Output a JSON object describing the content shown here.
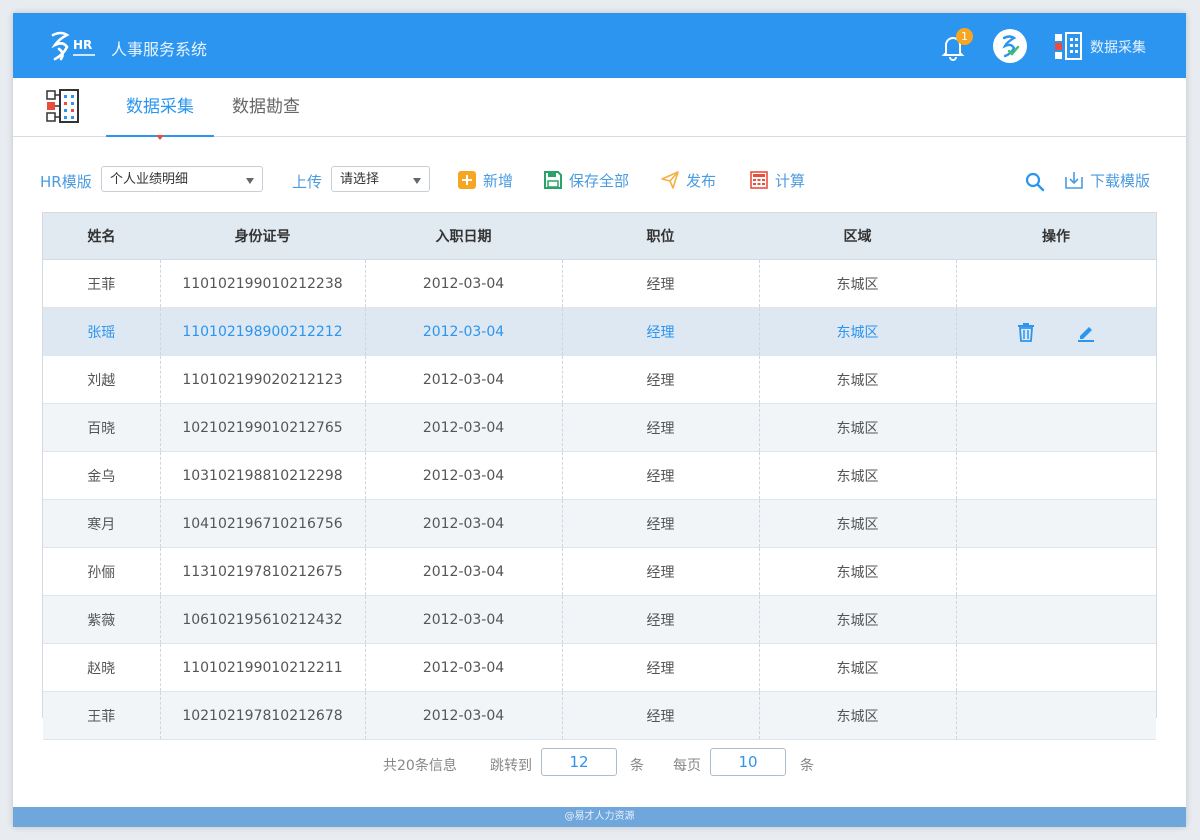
{
  "header": {
    "app_title": "人事服务系统",
    "notification_count": "1",
    "module_label": "数据采集"
  },
  "tabs": [
    {
      "label": "数据采集",
      "active": true
    },
    {
      "label": "数据勘查",
      "active": false
    }
  ],
  "toolbar": {
    "template_label": "HR模版",
    "template_value": "个人业绩明细",
    "upload_label": "上传",
    "upload_value": "请选择",
    "add_label": "新增",
    "save_all_label": "保存全部",
    "publish_label": "发布",
    "calculate_label": "计算",
    "download_label": "下载模版"
  },
  "table": {
    "columns": [
      "姓名",
      "身份证号",
      "入职日期",
      "职位",
      "区域",
      "操作"
    ],
    "rows": [
      {
        "name": "王菲",
        "id": "110102199010212238",
        "date": "2012-03-04",
        "position": "经理",
        "region": "东城区"
      },
      {
        "name": "张瑶",
        "id": "110102198900212212",
        "date": "2012-03-04",
        "position": "经理",
        "region": "东城区"
      },
      {
        "name": "刘越",
        "id": "110102199020212123",
        "date": "2012-03-04",
        "position": "经理",
        "region": "东城区"
      },
      {
        "name": "百晓",
        "id": "102102199010212765",
        "date": "2012-03-04",
        "position": "经理",
        "region": "东城区"
      },
      {
        "name": "金乌",
        "id": "103102198810212298",
        "date": "2012-03-04",
        "position": "经理",
        "region": "东城区"
      },
      {
        "name": "寒月",
        "id": "104102196710216756",
        "date": "2012-03-04",
        "position": "经理",
        "region": "东城区"
      },
      {
        "name": "孙俪",
        "id": "113102197810212675",
        "date": "2012-03-04",
        "position": "经理",
        "region": "东城区"
      },
      {
        "name": "紫薇",
        "id": "106102195610212432",
        "date": "2012-03-04",
        "position": "经理",
        "region": "东城区"
      },
      {
        "name": "赵晓",
        "id": "110102199010212211",
        "date": "2012-03-04",
        "position": "经理",
        "region": "东城区"
      },
      {
        "name": "王菲",
        "id": "102102197810212678",
        "date": "2012-03-04",
        "position": "经理",
        "region": "东城区"
      }
    ]
  },
  "pagination": {
    "total_text": "共20条信息",
    "jump_label": "跳转到",
    "jump_value": "12",
    "unit1": "条",
    "per_page_label": "每页",
    "per_page_value": "10",
    "unit2": "条"
  },
  "footer": {
    "text": "@易才人力资源"
  },
  "colors": {
    "primary": "#2b95ef",
    "header_bg": "#2b95ef",
    "selected_row": "#dde8f2",
    "badge": "#f6a623"
  }
}
